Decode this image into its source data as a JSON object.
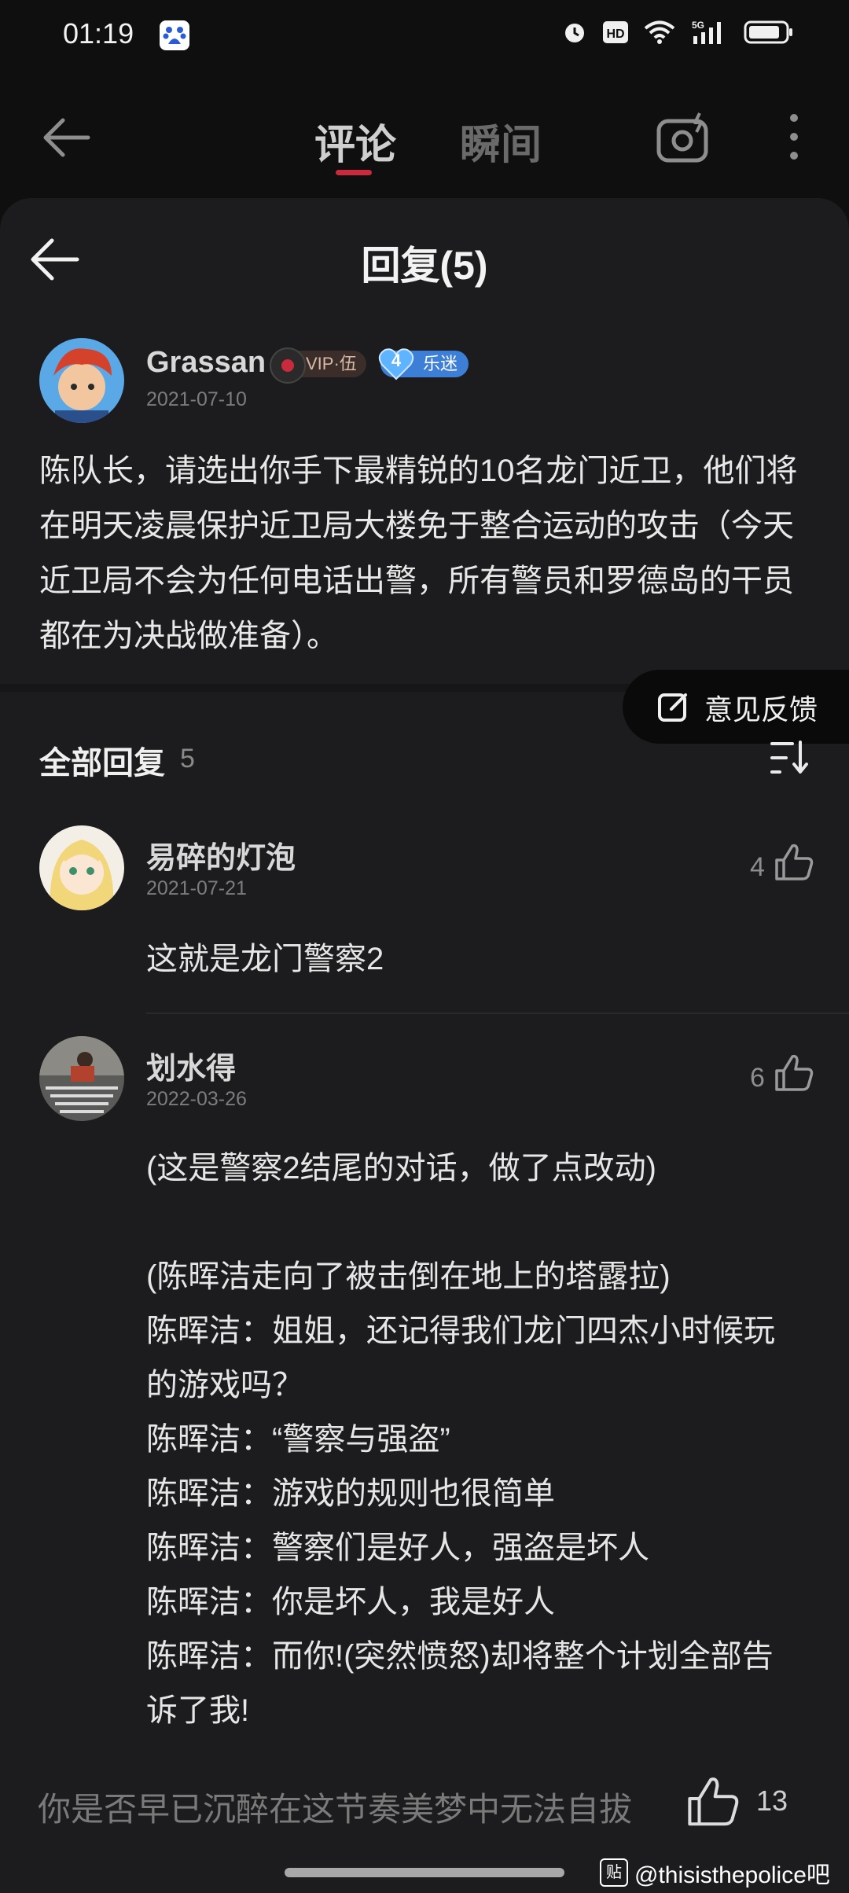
{
  "status_bar": {
    "time": "01:19",
    "net_label": "5G",
    "hd_label": "HD"
  },
  "nav": {
    "tabs": [
      {
        "label": "评论",
        "active": true
      },
      {
        "label": "瞬间",
        "active": false
      }
    ]
  },
  "sheet": {
    "title": "回复(5)"
  },
  "post": {
    "username": "Grassan",
    "vip_label": "VIP·伍",
    "fan_level": "4",
    "fan_label": "乐迷",
    "date": "2021-07-10",
    "text": "陈队长，请选出你手下最精锐的10名龙门近卫，他们将在明天凌晨保护近卫局大楼免于整合运动的攻击（今天近卫局不会为任何电话出警，所有警员和罗德岛的干员都在为决战做准备）。"
  },
  "feedback": {
    "label": "意见反馈"
  },
  "replies_header": {
    "label": "全部回复",
    "count": "5"
  },
  "replies": [
    {
      "username": "易碎的灯泡",
      "date": "2021-07-21",
      "likes": "4",
      "lines": [
        "这就是龙门警察2"
      ]
    },
    {
      "username": "划水得",
      "date": "2022-03-26",
      "likes": "6",
      "lines": [
        "(这是警察2结尾的对话，做了点改动)",
        "",
        "(陈晖洁走向了被击倒在地上的塔露拉)",
        "陈晖洁：姐姐，还记得我们龙门四杰小时候玩",
        "的游戏吗？",
        "陈晖洁：“警察与强盗”",
        "陈晖洁：游戏的规则也很简单",
        "陈晖洁：警察们是好人，强盗是坏人",
        "陈晖洁：你是坏人，我是好人",
        "陈晖洁：而你!(突然愤怒)却将整个计划全部告",
        "诉了我!"
      ]
    }
  ],
  "bottom": {
    "input_hint": "你是否早已沉醉在这节奏美梦中无法自拔",
    "like_count": "13"
  },
  "watermark": {
    "box_label": "贴",
    "text": "@thisisthepolice吧"
  },
  "colors": {
    "accent": "#c92a3c",
    "sheet_bg": "#1c1c1e",
    "page_bg": "#0f0f10"
  }
}
